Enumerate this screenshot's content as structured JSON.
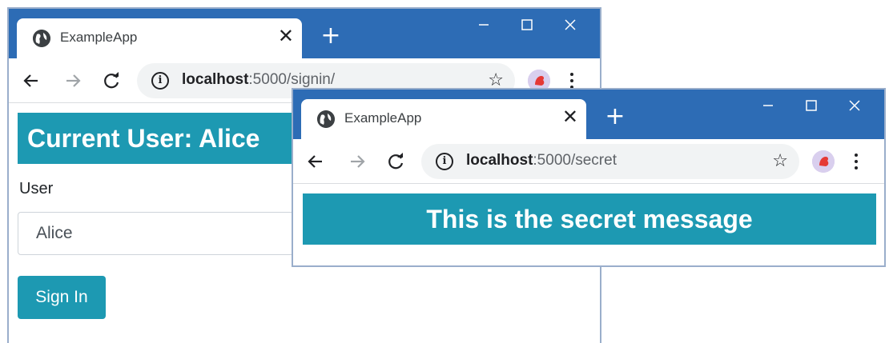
{
  "colors": {
    "titlebar": "#2d6cb5",
    "accent": "#1d99b2",
    "window_border": "#9aaecb",
    "omnibox_bg": "#f1f3f4"
  },
  "window_back": {
    "tab": {
      "title": "ExampleApp",
      "close": "✕",
      "icon": "globe-icon"
    },
    "new_tab": "+",
    "address": {
      "host": "localhost",
      "path": ":5000/signin/"
    },
    "page": {
      "heading": "Current User: Alice",
      "user_label": "User",
      "user_select_value": "Alice",
      "signin_button": "Sign In"
    }
  },
  "window_front": {
    "tab": {
      "title": "ExampleApp",
      "close": "✕",
      "icon": "globe-icon"
    },
    "new_tab": "+",
    "address": {
      "host": "localhost",
      "path": ":5000/secret"
    },
    "page": {
      "message": "This is the secret message"
    }
  },
  "toolbar_icons": {
    "back": "arrow-left-icon",
    "forward": "arrow-right-icon",
    "reload": "reload-icon",
    "info": "info-icon",
    "info_glyph": "i",
    "star": "star-icon",
    "star_glyph": "☆",
    "avatar": "profile-avatar",
    "menu": "more-vert-icon"
  }
}
